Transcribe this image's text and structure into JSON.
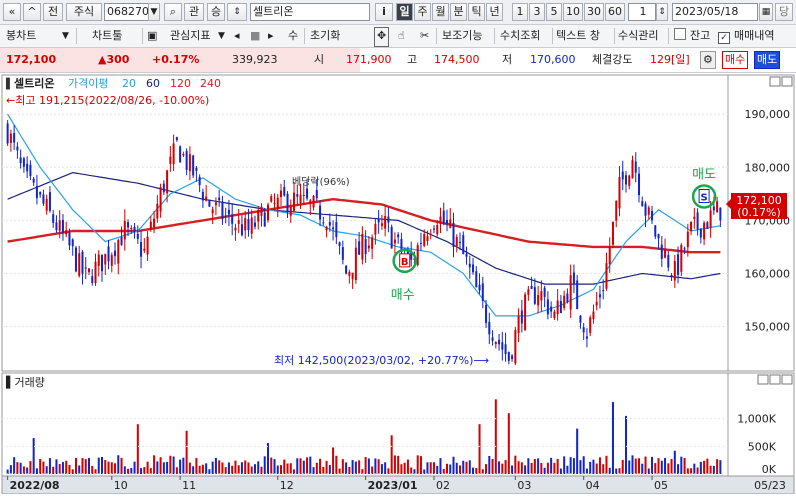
{
  "toolbar1": {
    "prev_symbol": "«",
    "market_toggle": "전",
    "market_type": "주식",
    "code": "068270",
    "search_glyph": "⌕",
    "relation_btn": "관",
    "updown_btn": "승",
    "stock_name": "셀트리온",
    "info_btn": "i",
    "periods": [
      "일",
      "주",
      "월",
      "분",
      "틱",
      "년"
    ],
    "active_period": "일",
    "intervals": [
      "1",
      "3",
      "5",
      "10",
      "30",
      "60"
    ],
    "count_value": "1",
    "date": "2023/05/18",
    "cal_icon_text": "▦",
    "end_btn": "당"
  },
  "toolbar2": {
    "candle_label": "봉차트",
    "chart_tools_label": "차트툴",
    "indicator_label": "관심지표",
    "numeric_label": "수",
    "reset_label": "초기화",
    "aux_label": "보조기능",
    "query_label": "수치조회",
    "text_window_label": "텍스트 창",
    "formula_label": "수식관리",
    "balance_label": "잔고",
    "trade_label": "매매내역"
  },
  "quote": {
    "price": "172,100",
    "change": "▲300",
    "change_pct": "+0.17%",
    "volume": "339,923",
    "open_label": "시",
    "open": "171,900",
    "high_label": "고",
    "high": "174,500",
    "low_label": "저",
    "low": "170,600",
    "strength_label": "체결강도",
    "strength": "129[일]",
    "buy_label": "매수",
    "sell_label": "매도"
  },
  "chart_data": {
    "type": "candlestick",
    "title": "셀트리온",
    "ma_label": "가격이평",
    "ma_periods": [
      "20",
      "60",
      "120",
      "240"
    ],
    "ma_colors": [
      "#2aa0e6",
      "#1a237e",
      "#d42020",
      "#d42020"
    ],
    "up_color": "#d40000",
    "down_color": "#1226c8",
    "y_ticks": [
      "190,000",
      "180,000",
      "170,000",
      "160,000",
      "150,000"
    ],
    "y_tick_values": [
      190000,
      180000,
      170000,
      160000,
      150000
    ],
    "ylim": [
      142000,
      194000
    ],
    "x_labels": [
      "2022/08",
      "10",
      "11",
      "12",
      "2023/01",
      "02",
      "03",
      "04",
      "05"
    ],
    "x_label_indices": [
      0,
      32,
      53,
      83,
      110,
      131,
      156,
      177,
      198
    ],
    "x_end_label": "05/23",
    "last_price_tag": "172,100",
    "last_pct_tag": "(0.17%)",
    "high_annotation": "최고 191,215(2022/08/26, -10.00%)",
    "low_annotation": "최저 142,500(2023/03/02, +20.77%)",
    "signal_text": "베당락(96%)",
    "buy_signal_label": "매수",
    "sell_signal_label": "매도",
    "buy_badge": "B",
    "sell_badge": "S",
    "buy_signal_index": 122,
    "sell_signal_index": 214,
    "candle_count": 220,
    "close_path": [
      [
        0,
        187000
      ],
      [
        5,
        178000
      ],
      [
        12,
        172000
      ],
      [
        18,
        166000
      ],
      [
        24,
        159000
      ],
      [
        30,
        163000
      ],
      [
        36,
        168000
      ],
      [
        42,
        164000
      ],
      [
        47,
        175000
      ],
      [
        52,
        184000
      ],
      [
        57,
        179000
      ],
      [
        62,
        173000
      ],
      [
        68,
        170000
      ],
      [
        74,
        168000
      ],
      [
        80,
        172000
      ],
      [
        86,
        174000
      ],
      [
        92,
        173000
      ],
      [
        98,
        171000
      ],
      [
        104,
        160000
      ],
      [
        110,
        166000
      ],
      [
        116,
        169000
      ],
      [
        120,
        165000
      ],
      [
        124,
        162000
      ],
      [
        128,
        168000
      ],
      [
        132,
        171000
      ],
      [
        137,
        167000
      ],
      [
        141,
        162000
      ],
      [
        145,
        155000
      ],
      [
        150,
        148000
      ],
      [
        154,
        144000
      ],
      [
        158,
        153000
      ],
      [
        163,
        157000
      ],
      [
        168,
        152000
      ],
      [
        173,
        158000
      ],
      [
        178,
        149000
      ],
      [
        183,
        158000
      ],
      [
        188,
        176000
      ],
      [
        192,
        182000
      ],
      [
        196,
        172000
      ],
      [
        200,
        166000
      ],
      [
        205,
        160000
      ],
      [
        210,
        168000
      ],
      [
        215,
        170000
      ],
      [
        219,
        172100
      ]
    ],
    "ma20_path": [
      [
        0,
        190000
      ],
      [
        10,
        180000
      ],
      [
        20,
        172000
      ],
      [
        30,
        166000
      ],
      [
        40,
        168000
      ],
      [
        50,
        175000
      ],
      [
        60,
        178000
      ],
      [
        70,
        174000
      ],
      [
        80,
        172000
      ],
      [
        90,
        171000
      ],
      [
        100,
        168000
      ],
      [
        110,
        167000
      ],
      [
        120,
        165000
      ],
      [
        130,
        164000
      ],
      [
        140,
        160000
      ],
      [
        150,
        152000
      ],
      [
        160,
        152000
      ],
      [
        170,
        154000
      ],
      [
        180,
        157000
      ],
      [
        190,
        166000
      ],
      [
        200,
        172000
      ],
      [
        210,
        168000
      ],
      [
        219,
        169000
      ]
    ],
    "ma60_path": [
      [
        0,
        174000
      ],
      [
        20,
        179000
      ],
      [
        40,
        177000
      ],
      [
        60,
        174000
      ],
      [
        80,
        172000
      ],
      [
        100,
        171000
      ],
      [
        120,
        170000
      ],
      [
        135,
        166000
      ],
      [
        150,
        161000
      ],
      [
        165,
        158000
      ],
      [
        180,
        158000
      ],
      [
        195,
        160000
      ],
      [
        210,
        159000
      ],
      [
        219,
        160000
      ]
    ],
    "ma120_path": [
      [
        0,
        166000
      ],
      [
        20,
        168000
      ],
      [
        40,
        168000
      ],
      [
        60,
        170000
      ],
      [
        80,
        172000
      ],
      [
        100,
        174000
      ],
      [
        115,
        173000
      ],
      [
        130,
        170000
      ],
      [
        145,
        168000
      ],
      [
        160,
        166000
      ],
      [
        180,
        165000
      ],
      [
        195,
        165000
      ],
      [
        210,
        164000
      ],
      [
        219,
        164000
      ]
    ],
    "volume_panel": {
      "label": "거래량",
      "y_ticks": [
        "1,000K",
        "500K",
        "0K"
      ],
      "y_tick_values": [
        1000000,
        500000,
        0
      ],
      "ymax": 1500000,
      "spikes": [
        [
          8,
          650000
        ],
        [
          40,
          900000
        ],
        [
          55,
          780000
        ],
        [
          80,
          560000
        ],
        [
          100,
          480000
        ],
        [
          118,
          700000
        ],
        [
          145,
          900000
        ],
        [
          150,
          1350000
        ],
        [
          154,
          1100000
        ],
        [
          175,
          820000
        ],
        [
          186,
          1300000
        ],
        [
          190,
          1050000
        ],
        [
          205,
          420000
        ]
      ]
    }
  }
}
